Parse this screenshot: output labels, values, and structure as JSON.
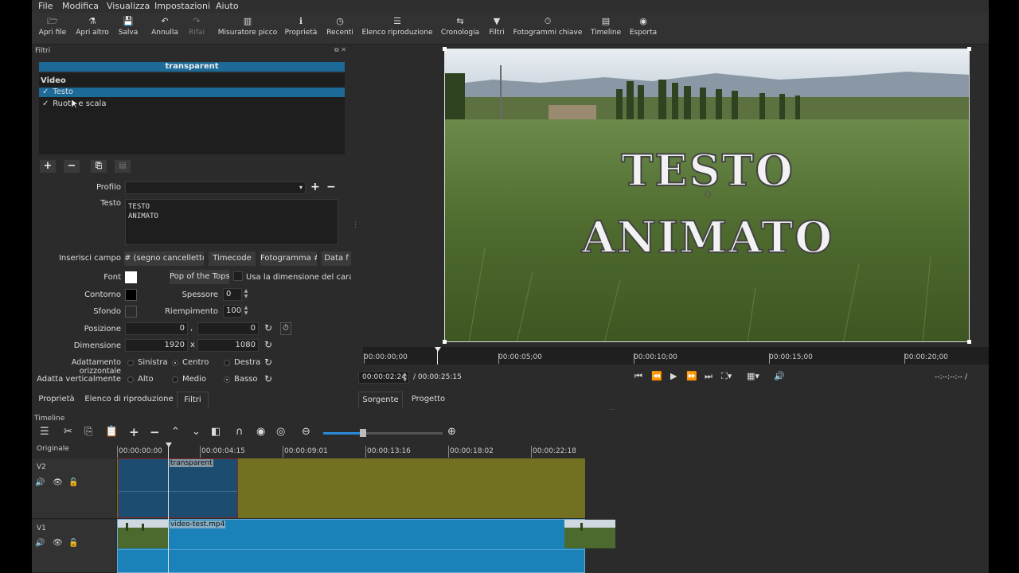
{
  "menu": [
    "File",
    "Modifica",
    "Visualizza",
    "Impostazioni",
    "Aiuto"
  ],
  "toolbar": [
    {
      "label": "Apri file",
      "icon": "open-file-icon",
      "glyph": "🗁",
      "disabled": false
    },
    {
      "label": "Apri altro",
      "icon": "open-other-icon",
      "glyph": "⚗",
      "disabled": false
    },
    {
      "label": "Salva",
      "icon": "save-icon",
      "glyph": "💾",
      "disabled": false
    },
    {
      "label": "Annulla",
      "icon": "undo-icon",
      "glyph": "↶",
      "disabled": false
    },
    {
      "label": "Rifai",
      "icon": "redo-icon",
      "glyph": "↷",
      "disabled": true
    },
    {
      "label": "Misuratore picco",
      "icon": "peak-meter-icon",
      "glyph": "▥",
      "disabled": false
    },
    {
      "label": "Proprietà",
      "icon": "info-icon",
      "glyph": "ℹ",
      "disabled": false
    },
    {
      "label": "Recenti",
      "icon": "clock-icon",
      "glyph": "◷",
      "disabled": false
    },
    {
      "label": "Elenco riproduzione",
      "icon": "list-icon",
      "glyph": "☰",
      "disabled": false
    },
    {
      "label": "Cronologia",
      "icon": "history-icon",
      "glyph": "⇆",
      "disabled": false
    },
    {
      "label": "Filtri",
      "icon": "filter-icon",
      "glyph": "▼",
      "disabled": false
    },
    {
      "label": "Fotogrammi chiave",
      "icon": "stopwatch-icon",
      "glyph": "⏱",
      "disabled": false
    },
    {
      "label": "Timeline",
      "icon": "timeline-icon",
      "glyph": "▤",
      "disabled": false
    },
    {
      "label": "Esporta",
      "icon": "export-icon",
      "glyph": "◉",
      "disabled": false
    }
  ],
  "filters": {
    "panel_title": "Filtri",
    "header": "transparent",
    "group": "Video",
    "items": [
      {
        "label": "Testo",
        "checked": true,
        "selected": true
      },
      {
        "label": "Ruota e scala",
        "checked": true,
        "selected": false
      }
    ]
  },
  "form": {
    "profilo_label": "Profilo",
    "profilo_value": "",
    "testo_label": "Testo",
    "testo_value": "TESTO\nANIMATO",
    "inserisci_label": "Inserisci campo",
    "insert_buttons": [
      "# (segno cancelletto)",
      "Timecode",
      "Fotogramma #",
      "Data f"
    ],
    "font_label": "Font",
    "font_name": "Pop of the Tops",
    "use_size_label": "Usa la dimensione del carattere",
    "contorno_label": "Contorno",
    "spessore_label": "Spessore",
    "spessore_value": "0",
    "sfondo_label": "Sfondo",
    "riempimento_label": "Riempimento",
    "riempimento_value": "100",
    "posizione_label": "Posizione",
    "pos_x": "0",
    "pos_sep": ",",
    "pos_y": "0",
    "dimensione_label": "Dimensione",
    "dim_w": "1920",
    "dim_sep": "x",
    "dim_h": "1080",
    "h_align_label": "Adattamento orizzontale",
    "h_options": [
      "Sinistra",
      "Centro",
      "Destra"
    ],
    "h_selected": "Centro",
    "v_align_label": "Adatta verticalmente",
    "v_options": [
      "Alto",
      "Medio",
      "Basso"
    ],
    "v_selected": "Basso"
  },
  "panel_tabs": [
    "Proprietà",
    "Elenco di riproduzione",
    "Filtri"
  ],
  "player": {
    "overlay_line1": "TESTO",
    "overlay_line2": "ANIMATO",
    "ruler_ticks": [
      "00:00:00;00",
      "00:00:05;00",
      "00:00:10;00",
      "00:00:15;00",
      "00:00:20;00"
    ],
    "current_time": "00:00:02:24",
    "total_time": "/ 00:00:25:15",
    "right_time": "--:--:--:-- /",
    "tabs": [
      "Sorgente",
      "Progetto"
    ]
  },
  "timeline": {
    "label": "Timeline",
    "originale": "Originale",
    "ticks": [
      "00:00:00:00",
      "00:00:04:15",
      "00:00:09:01",
      "00:00:13:16",
      "00:00:18:02",
      "00:00:22:18"
    ],
    "tracks": [
      {
        "name": "V2",
        "clip": "transparent"
      },
      {
        "name": "V1",
        "clip": "video-test.mp4"
      }
    ]
  }
}
